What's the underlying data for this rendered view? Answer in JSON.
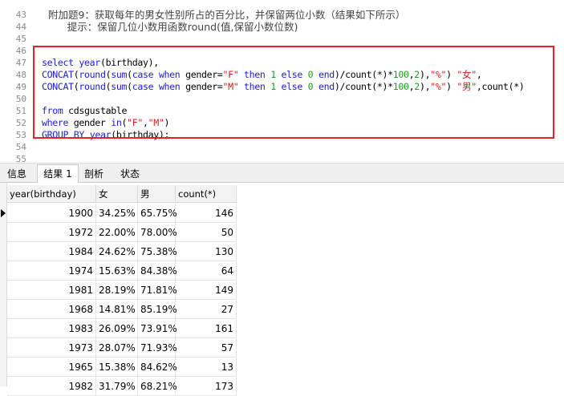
{
  "editor": {
    "line_numbers": [
      "43",
      "44",
      "45",
      "46",
      "47",
      "48",
      "49",
      "50",
      "51",
      "52",
      "53",
      "54",
      "55"
    ],
    "comment_line1": "附加题9：获取每年的男女性别所占的百分比，并保留两位小数（结果如下所示）",
    "comment_line2": "提示：保留几位小数用函数round(值,保留小数位数)",
    "sql": {
      "l47": [
        "select",
        " ",
        "year",
        "(birthday),"
      ],
      "l48": [
        "CONCAT",
        "(",
        "round",
        "(",
        "sum",
        "(",
        "case",
        " ",
        "when",
        " gender=",
        "\"F\"",
        " ",
        "then",
        " ",
        "1",
        " ",
        "else",
        " ",
        "0",
        " ",
        "end",
        ")/count(*)*",
        "100",
        ",",
        "2",
        "),",
        "\"%\"",
        ") ",
        "\"女\"",
        ","
      ],
      "l49": [
        "CONCAT",
        "(",
        "round",
        "(",
        "sum",
        "(",
        "case",
        " ",
        "when",
        " gender=",
        "\"M\"",
        " ",
        "then",
        " ",
        "1",
        " ",
        "else",
        " ",
        "0",
        " ",
        "end",
        ")/count(*)*",
        "100",
        ",",
        "2",
        "),",
        "\"%\"",
        ") ",
        "\"男\"",
        ",count(*)"
      ],
      "l51": [
        "from",
        " cdsgustable"
      ],
      "l52": [
        "where",
        " gender ",
        "in",
        "(",
        "\"F\"",
        ",",
        "\"M\"",
        ")"
      ],
      "l53": [
        "GROUP BY",
        " ",
        "year",
        "(birthday);"
      ]
    }
  },
  "tabs": [
    {
      "label": "信息",
      "active": false
    },
    {
      "label": "结果 1",
      "active": true
    },
    {
      "label": "剖析",
      "active": false
    },
    {
      "label": "状态",
      "active": false
    }
  ],
  "result": {
    "columns": [
      "year(birthday)",
      "女",
      "男",
      "count(*)"
    ],
    "rows": [
      [
        "1900",
        "34.25%",
        "65.75%",
        "146"
      ],
      [
        "1972",
        "22.00%",
        "78.00%",
        "50"
      ],
      [
        "1984",
        "24.62%",
        "75.38%",
        "130"
      ],
      [
        "1974",
        "15.63%",
        "84.38%",
        "64"
      ],
      [
        "1981",
        "28.19%",
        "71.81%",
        "149"
      ],
      [
        "1968",
        "14.81%",
        "85.19%",
        "27"
      ],
      [
        "1983",
        "26.09%",
        "73.91%",
        "161"
      ],
      [
        "1973",
        "28.07%",
        "71.93%",
        "57"
      ],
      [
        "1965",
        "15.38%",
        "84.62%",
        "13"
      ],
      [
        "1982",
        "31.79%",
        "68.21%",
        "173"
      ]
    ]
  },
  "colors": {
    "highlight_border": "#e0242a",
    "keyword": "#2020d8",
    "string": "#cc1f1f",
    "number": "#1f9a1f"
  }
}
